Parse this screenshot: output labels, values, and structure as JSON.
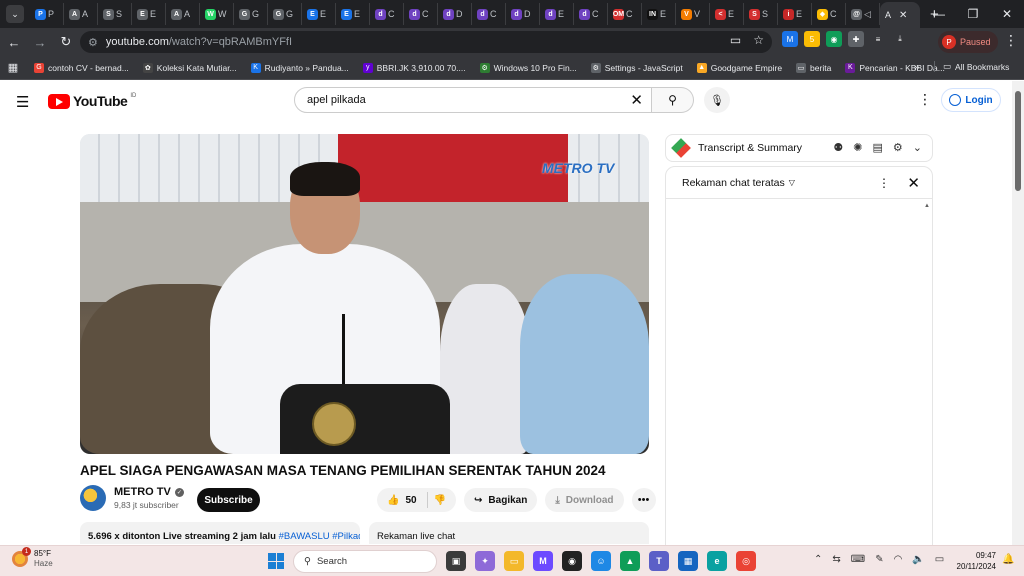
{
  "browser": {
    "tabs": [
      {
        "fav": "P",
        "color": "#1a73e8",
        "title": "P"
      },
      {
        "fav": "A",
        "color": "#5f6368",
        "title": "A"
      },
      {
        "fav": "S",
        "color": "#5f6368",
        "title": "S"
      },
      {
        "fav": "E",
        "color": "#5f6368",
        "title": "E"
      },
      {
        "fav": "A",
        "color": "#5f6368",
        "title": "A"
      },
      {
        "fav": "W",
        "color": "#25d366",
        "title": "W"
      },
      {
        "fav": "G",
        "color": "#5f6368",
        "title": "G"
      },
      {
        "fav": "G",
        "color": "#5f6368",
        "title": "G"
      },
      {
        "fav": "E",
        "color": "#1a73e8",
        "title": "E"
      },
      {
        "fav": "E",
        "color": "#1a73e8",
        "title": "E"
      },
      {
        "fav": "d",
        "color": "#6f42c1",
        "title": "C"
      },
      {
        "fav": "d",
        "color": "#6f42c1",
        "title": "C"
      },
      {
        "fav": "d",
        "color": "#6f42c1",
        "title": "D"
      },
      {
        "fav": "d",
        "color": "#6f42c1",
        "title": "C"
      },
      {
        "fav": "d",
        "color": "#6f42c1",
        "title": "D"
      },
      {
        "fav": "d",
        "color": "#6f42c1",
        "title": "E"
      },
      {
        "fav": "d",
        "color": "#6f42c1",
        "title": "C"
      },
      {
        "fav": "OM",
        "color": "#d32f2f",
        "title": "C"
      },
      {
        "fav": "IN",
        "color": "#111",
        "title": "E"
      },
      {
        "fav": "V",
        "color": "#f57c00",
        "title": "V"
      },
      {
        "fav": "<",
        "color": "#d32f2f",
        "title": "E"
      },
      {
        "fav": "S",
        "color": "#d32f2f",
        "title": "S"
      },
      {
        "fav": "i",
        "color": "#c62828",
        "title": "E"
      },
      {
        "fav": "◆",
        "color": "#fbbc04",
        "title": "C"
      },
      {
        "fav": "@",
        "color": "#5f6368",
        "title": "◁"
      }
    ],
    "active_tab": {
      "title": "A"
    },
    "url_host": "youtube.com",
    "url_path": "/watch?v=qbRAMBmYFfI",
    "paused_label": "Paused",
    "paused_avatar": "P",
    "bookmarks": [
      {
        "icon": "G",
        "color": "#ea4335",
        "label": "contoh CV - bernad..."
      },
      {
        "icon": "✿",
        "color": "#444",
        "label": "Koleksi Kata Mutiar..."
      },
      {
        "icon": "K",
        "color": "#1a73e8",
        "label": "Rudiyanto » Pandua..."
      },
      {
        "icon": "y",
        "color": "#6001d2",
        "label": "BBRI.JK 3,910.00 70...."
      },
      {
        "icon": "⚙",
        "color": "#2e7d32",
        "label": "Windows 10 Pro Fin..."
      },
      {
        "icon": "⚙",
        "color": "#5f6368",
        "label": "Settings - JavaScript"
      },
      {
        "icon": "▲",
        "color": "#f9a825",
        "label": "Goodgame Empire"
      },
      {
        "icon": "▭",
        "color": "#5f6368",
        "label": "berita"
      },
      {
        "icon": "K",
        "color": "#6a1b9a",
        "label": "Pencarian - KBBI Da..."
      }
    ],
    "bookmarks_more": "»",
    "all_bookmarks": "All Bookmarks"
  },
  "youtube": {
    "logo_text": "YouTube",
    "country": "ID",
    "search_value": "apel pilkada",
    "login_label": "Login",
    "video_watermark": "METRO TV",
    "video_title": "APEL SIAGA PENGAWASAN MASA TENANG PEMILIHAN SERENTAK TAHUN 2024",
    "channel_name": "METRO TV",
    "subscribers": "9,83 jt subscriber",
    "subscribe_label": "Subscribe",
    "like_count": "50",
    "share_label": "Bagikan",
    "download_label": "Download",
    "desc_stats": "5.696 x ditonton  Live streaming 2 jam lalu",
    "desc_tags": "#BAWASLU #Pilkada",
    "live_chat_box": "Rekaman live chat",
    "transcript_label": "Transcript & Summary",
    "chat_header": "Rekaman chat teratas"
  },
  "taskbar": {
    "temp": "85°F",
    "condition": "Haze",
    "weather_badge": "1",
    "search_label": "Search",
    "time": "09:47",
    "date": "20/11/2024"
  }
}
